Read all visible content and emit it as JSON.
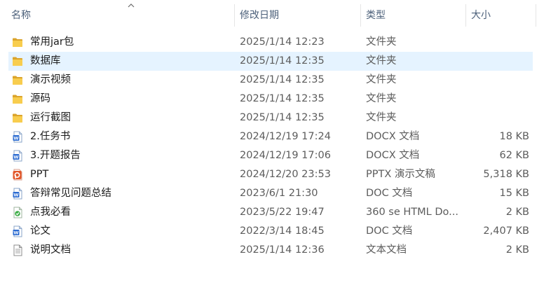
{
  "columns": {
    "name": "名称",
    "date": "修改日期",
    "type": "类型",
    "size": "大小"
  },
  "files": [
    {
      "name": "常用jar包",
      "date": "2025/1/14 12:23",
      "type": "文件夹",
      "size": "",
      "icon": "folder-icon"
    },
    {
      "name": "数据库",
      "date": "2025/1/14 12:35",
      "type": "文件夹",
      "size": "",
      "icon": "folder-icon"
    },
    {
      "name": "演示视频",
      "date": "2025/1/14 12:35",
      "type": "文件夹",
      "size": "",
      "icon": "folder-icon"
    },
    {
      "name": "源码",
      "date": "2025/1/14 12:35",
      "type": "文件夹",
      "size": "",
      "icon": "folder-icon"
    },
    {
      "name": "运行截图",
      "date": "2025/1/14 12:35",
      "type": "文件夹",
      "size": "",
      "icon": "folder-icon"
    },
    {
      "name": "2.任务书",
      "date": "2024/12/19 17:24",
      "type": "DOCX 文档",
      "size": "18 KB",
      "icon": "word-doc-icon"
    },
    {
      "name": "3.开题报告",
      "date": "2024/12/19 17:06",
      "type": "DOCX 文档",
      "size": "62 KB",
      "icon": "word-doc-icon"
    },
    {
      "name": "PPT",
      "date": "2024/12/20 23:53",
      "type": "PPTX 演示文稿",
      "size": "5,318 KB",
      "icon": "ppt-icon"
    },
    {
      "name": "答辩常见问题总结",
      "date": "2023/6/1 21:30",
      "type": "DOC 文档",
      "size": "15 KB",
      "icon": "word-doc-icon"
    },
    {
      "name": "点我必看",
      "date": "2023/5/22 19:47",
      "type": "360 se HTML Do...",
      "size": "2 KB",
      "icon": "html-doc-icon"
    },
    {
      "name": "论文",
      "date": "2022/3/14 18:45",
      "type": "DOC 文档",
      "size": "2,407 KB",
      "icon": "word-doc-icon"
    },
    {
      "name": "说明文档",
      "date": "2025/1/14 12:36",
      "type": "文本文档",
      "size": "2 KB",
      "icon": "text-doc-icon"
    }
  ],
  "selected_index": 1
}
